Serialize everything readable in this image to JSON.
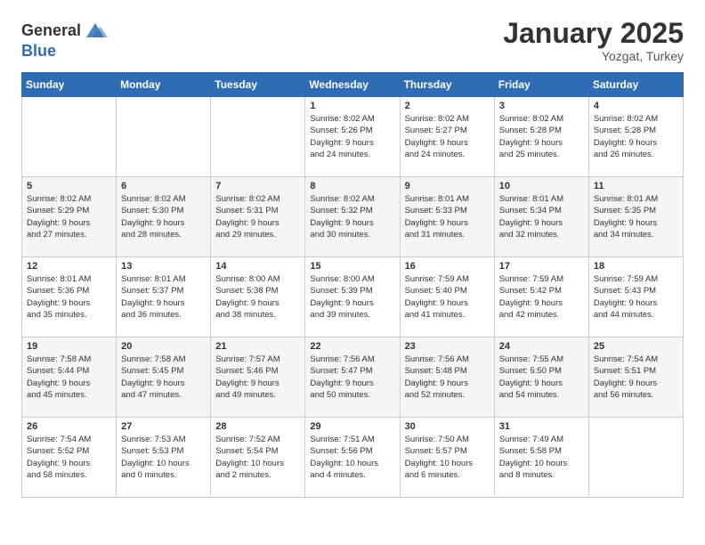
{
  "logo": {
    "general": "General",
    "blue": "Blue"
  },
  "title": "January 2025",
  "location": "Yozgat, Turkey",
  "headers": [
    "Sunday",
    "Monday",
    "Tuesday",
    "Wednesday",
    "Thursday",
    "Friday",
    "Saturday"
  ],
  "weeks": [
    [
      {
        "day": "",
        "info": ""
      },
      {
        "day": "",
        "info": ""
      },
      {
        "day": "",
        "info": ""
      },
      {
        "day": "1",
        "info": "Sunrise: 8:02 AM\nSunset: 5:26 PM\nDaylight: 9 hours\nand 24 minutes."
      },
      {
        "day": "2",
        "info": "Sunrise: 8:02 AM\nSunset: 5:27 PM\nDaylight: 9 hours\nand 24 minutes."
      },
      {
        "day": "3",
        "info": "Sunrise: 8:02 AM\nSunset: 5:28 PM\nDaylight: 9 hours\nand 25 minutes."
      },
      {
        "day": "4",
        "info": "Sunrise: 8:02 AM\nSunset: 5:28 PM\nDaylight: 9 hours\nand 26 minutes."
      }
    ],
    [
      {
        "day": "5",
        "info": "Sunrise: 8:02 AM\nSunset: 5:29 PM\nDaylight: 9 hours\nand 27 minutes."
      },
      {
        "day": "6",
        "info": "Sunrise: 8:02 AM\nSunset: 5:30 PM\nDaylight: 9 hours\nand 28 minutes."
      },
      {
        "day": "7",
        "info": "Sunrise: 8:02 AM\nSunset: 5:31 PM\nDaylight: 9 hours\nand 29 minutes."
      },
      {
        "day": "8",
        "info": "Sunrise: 8:02 AM\nSunset: 5:32 PM\nDaylight: 9 hours\nand 30 minutes."
      },
      {
        "day": "9",
        "info": "Sunrise: 8:01 AM\nSunset: 5:33 PM\nDaylight: 9 hours\nand 31 minutes."
      },
      {
        "day": "10",
        "info": "Sunrise: 8:01 AM\nSunset: 5:34 PM\nDaylight: 9 hours\nand 32 minutes."
      },
      {
        "day": "11",
        "info": "Sunrise: 8:01 AM\nSunset: 5:35 PM\nDaylight: 9 hours\nand 34 minutes."
      }
    ],
    [
      {
        "day": "12",
        "info": "Sunrise: 8:01 AM\nSunset: 5:36 PM\nDaylight: 9 hours\nand 35 minutes."
      },
      {
        "day": "13",
        "info": "Sunrise: 8:01 AM\nSunset: 5:37 PM\nDaylight: 9 hours\nand 36 minutes."
      },
      {
        "day": "14",
        "info": "Sunrise: 8:00 AM\nSunset: 5:38 PM\nDaylight: 9 hours\nand 38 minutes."
      },
      {
        "day": "15",
        "info": "Sunrise: 8:00 AM\nSunset: 5:39 PM\nDaylight: 9 hours\nand 39 minutes."
      },
      {
        "day": "16",
        "info": "Sunrise: 7:59 AM\nSunset: 5:40 PM\nDaylight: 9 hours\nand 41 minutes."
      },
      {
        "day": "17",
        "info": "Sunrise: 7:59 AM\nSunset: 5:42 PM\nDaylight: 9 hours\nand 42 minutes."
      },
      {
        "day": "18",
        "info": "Sunrise: 7:59 AM\nSunset: 5:43 PM\nDaylight: 9 hours\nand 44 minutes."
      }
    ],
    [
      {
        "day": "19",
        "info": "Sunrise: 7:58 AM\nSunset: 5:44 PM\nDaylight: 9 hours\nand 45 minutes."
      },
      {
        "day": "20",
        "info": "Sunrise: 7:58 AM\nSunset: 5:45 PM\nDaylight: 9 hours\nand 47 minutes."
      },
      {
        "day": "21",
        "info": "Sunrise: 7:57 AM\nSunset: 5:46 PM\nDaylight: 9 hours\nand 49 minutes."
      },
      {
        "day": "22",
        "info": "Sunrise: 7:56 AM\nSunset: 5:47 PM\nDaylight: 9 hours\nand 50 minutes."
      },
      {
        "day": "23",
        "info": "Sunrise: 7:56 AM\nSunset: 5:48 PM\nDaylight: 9 hours\nand 52 minutes."
      },
      {
        "day": "24",
        "info": "Sunrise: 7:55 AM\nSunset: 5:50 PM\nDaylight: 9 hours\nand 54 minutes."
      },
      {
        "day": "25",
        "info": "Sunrise: 7:54 AM\nSunset: 5:51 PM\nDaylight: 9 hours\nand 56 minutes."
      }
    ],
    [
      {
        "day": "26",
        "info": "Sunrise: 7:54 AM\nSunset: 5:52 PM\nDaylight: 9 hours\nand 58 minutes."
      },
      {
        "day": "27",
        "info": "Sunrise: 7:53 AM\nSunset: 5:53 PM\nDaylight: 10 hours\nand 0 minutes."
      },
      {
        "day": "28",
        "info": "Sunrise: 7:52 AM\nSunset: 5:54 PM\nDaylight: 10 hours\nand 2 minutes."
      },
      {
        "day": "29",
        "info": "Sunrise: 7:51 AM\nSunset: 5:56 PM\nDaylight: 10 hours\nand 4 minutes."
      },
      {
        "day": "30",
        "info": "Sunrise: 7:50 AM\nSunset: 5:57 PM\nDaylight: 10 hours\nand 6 minutes."
      },
      {
        "day": "31",
        "info": "Sunrise: 7:49 AM\nSunset: 5:58 PM\nDaylight: 10 hours\nand 8 minutes."
      },
      {
        "day": "",
        "info": ""
      }
    ]
  ]
}
